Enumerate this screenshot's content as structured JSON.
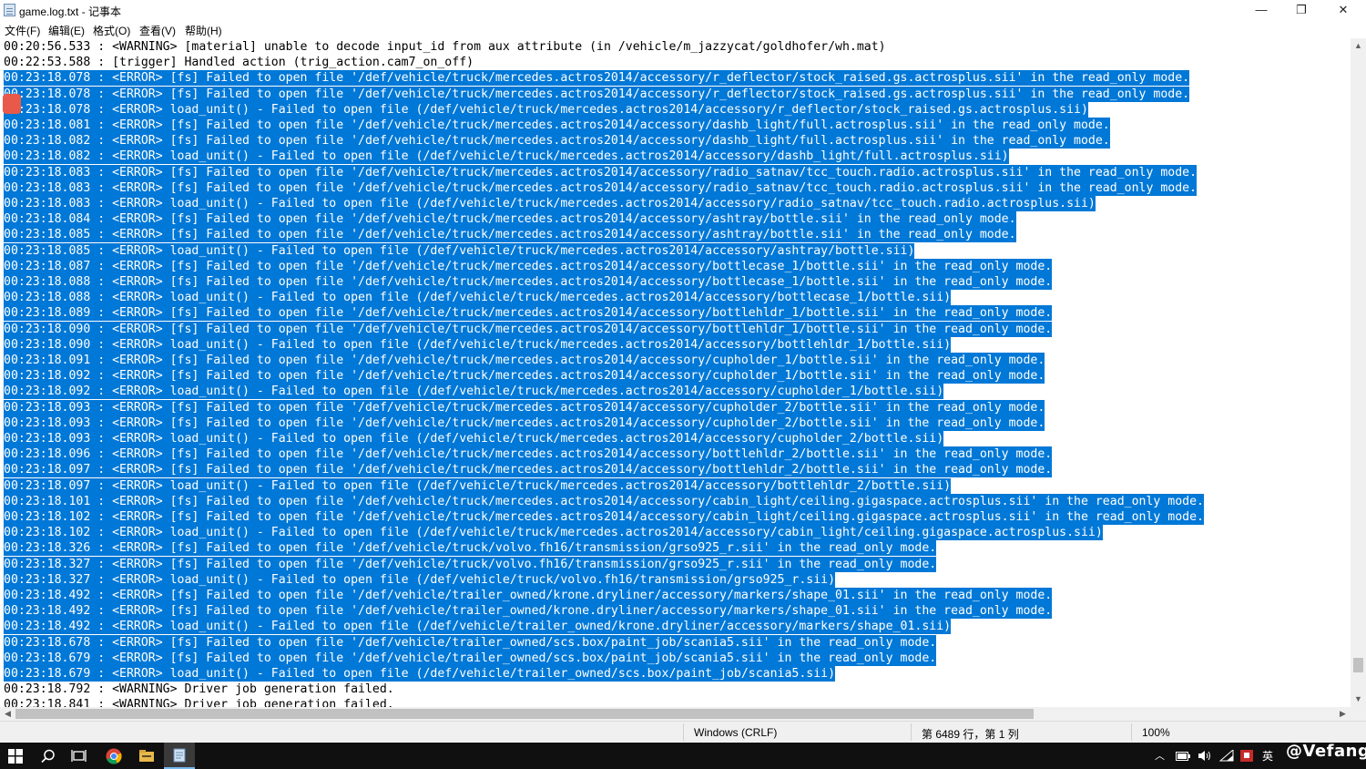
{
  "window": {
    "title": "game.log.txt - 记事本",
    "minimize": "—",
    "maximize": "❐",
    "close": "✕"
  },
  "menu": [
    "文件(F)",
    "编辑(E)",
    "格式(O)",
    "查看(V)",
    "帮助(H)"
  ],
  "editor": {
    "lines": [
      {
        "text": "00:20:56.533 : <WARNING> [material] unable to decode input_id from aux attribute (in /vehicle/m_jazzycat/goldhofer/wh.mat)",
        "selected": false
      },
      {
        "text": "00:22:53.588 : [trigger] Handled action (trig_action.cam7_on_off)",
        "selected": false
      },
      {
        "text": "00:23:18.078 : <ERROR> [fs] Failed to open file '/def/vehicle/truck/mercedes.actros2014/accessory/r_deflector/stock_raised.gs.actrosplus.sii' in the read_only mode.",
        "selected": true
      },
      {
        "text": "00:23:18.078 : <ERROR> [fs] Failed to open file '/def/vehicle/truck/mercedes.actros2014/accessory/r_deflector/stock_raised.gs.actrosplus.sii' in the read_only mode.",
        "selected": true
      },
      {
        "text": "00:23:18.078 : <ERROR> load_unit() - Failed to open file (/def/vehicle/truck/mercedes.actros2014/accessory/r_deflector/stock_raised.gs.actrosplus.sii)",
        "selected": true
      },
      {
        "text": "00:23:18.081 : <ERROR> [fs] Failed to open file '/def/vehicle/truck/mercedes.actros2014/accessory/dashb_light/full.actrosplus.sii' in the read_only mode.",
        "selected": true
      },
      {
        "text": "00:23:18.082 : <ERROR> [fs] Failed to open file '/def/vehicle/truck/mercedes.actros2014/accessory/dashb_light/full.actrosplus.sii' in the read_only mode.",
        "selected": true
      },
      {
        "text": "00:23:18.082 : <ERROR> load_unit() - Failed to open file (/def/vehicle/truck/mercedes.actros2014/accessory/dashb_light/full.actrosplus.sii)",
        "selected": true
      },
      {
        "text": "00:23:18.083 : <ERROR> [fs] Failed to open file '/def/vehicle/truck/mercedes.actros2014/accessory/radio_satnav/tcc_touch.radio.actrosplus.sii' in the read_only mode.",
        "selected": true
      },
      {
        "text": "00:23:18.083 : <ERROR> [fs] Failed to open file '/def/vehicle/truck/mercedes.actros2014/accessory/radio_satnav/tcc_touch.radio.actrosplus.sii' in the read_only mode.",
        "selected": true
      },
      {
        "text": "00:23:18.083 : <ERROR> load_unit() - Failed to open file (/def/vehicle/truck/mercedes.actros2014/accessory/radio_satnav/tcc_touch.radio.actrosplus.sii)",
        "selected": true
      },
      {
        "text": "00:23:18.084 : <ERROR> [fs] Failed to open file '/def/vehicle/truck/mercedes.actros2014/accessory/ashtray/bottle.sii' in the read_only mode.",
        "selected": true
      },
      {
        "text": "00:23:18.085 : <ERROR> [fs] Failed to open file '/def/vehicle/truck/mercedes.actros2014/accessory/ashtray/bottle.sii' in the read_only mode.",
        "selected": true
      },
      {
        "text": "00:23:18.085 : <ERROR> load_unit() - Failed to open file (/def/vehicle/truck/mercedes.actros2014/accessory/ashtray/bottle.sii)",
        "selected": true
      },
      {
        "text": "00:23:18.087 : <ERROR> [fs] Failed to open file '/def/vehicle/truck/mercedes.actros2014/accessory/bottlecase_1/bottle.sii' in the read_only mode.",
        "selected": true
      },
      {
        "text": "00:23:18.088 : <ERROR> [fs] Failed to open file '/def/vehicle/truck/mercedes.actros2014/accessory/bottlecase_1/bottle.sii' in the read_only mode.",
        "selected": true
      },
      {
        "text": "00:23:18.088 : <ERROR> load_unit() - Failed to open file (/def/vehicle/truck/mercedes.actros2014/accessory/bottlecase_1/bottle.sii)",
        "selected": true
      },
      {
        "text": "00:23:18.089 : <ERROR> [fs] Failed to open file '/def/vehicle/truck/mercedes.actros2014/accessory/bottlehldr_1/bottle.sii' in the read_only mode.",
        "selected": true
      },
      {
        "text": "00:23:18.090 : <ERROR> [fs] Failed to open file '/def/vehicle/truck/mercedes.actros2014/accessory/bottlehldr_1/bottle.sii' in the read_only mode.",
        "selected": true
      },
      {
        "text": "00:23:18.090 : <ERROR> load_unit() - Failed to open file (/def/vehicle/truck/mercedes.actros2014/accessory/bottlehldr_1/bottle.sii)",
        "selected": true
      },
      {
        "text": "00:23:18.091 : <ERROR> [fs] Failed to open file '/def/vehicle/truck/mercedes.actros2014/accessory/cupholder_1/bottle.sii' in the read_only mode.",
        "selected": true
      },
      {
        "text": "00:23:18.092 : <ERROR> [fs] Failed to open file '/def/vehicle/truck/mercedes.actros2014/accessory/cupholder_1/bottle.sii' in the read_only mode.",
        "selected": true
      },
      {
        "text": "00:23:18.092 : <ERROR> load_unit() - Failed to open file (/def/vehicle/truck/mercedes.actros2014/accessory/cupholder_1/bottle.sii)",
        "selected": true
      },
      {
        "text": "00:23:18.093 : <ERROR> [fs] Failed to open file '/def/vehicle/truck/mercedes.actros2014/accessory/cupholder_2/bottle.sii' in the read_only mode.",
        "selected": true
      },
      {
        "text": "00:23:18.093 : <ERROR> [fs] Failed to open file '/def/vehicle/truck/mercedes.actros2014/accessory/cupholder_2/bottle.sii' in the read_only mode.",
        "selected": true
      },
      {
        "text": "00:23:18.093 : <ERROR> load_unit() - Failed to open file (/def/vehicle/truck/mercedes.actros2014/accessory/cupholder_2/bottle.sii)",
        "selected": true
      },
      {
        "text": "00:23:18.096 : <ERROR> [fs] Failed to open file '/def/vehicle/truck/mercedes.actros2014/accessory/bottlehldr_2/bottle.sii' in the read_only mode.",
        "selected": true
      },
      {
        "text": "00:23:18.097 : <ERROR> [fs] Failed to open file '/def/vehicle/truck/mercedes.actros2014/accessory/bottlehldr_2/bottle.sii' in the read_only mode.",
        "selected": true
      },
      {
        "text": "00:23:18.097 : <ERROR> load_unit() - Failed to open file (/def/vehicle/truck/mercedes.actros2014/accessory/bottlehldr_2/bottle.sii)",
        "selected": true
      },
      {
        "text": "00:23:18.101 : <ERROR> [fs] Failed to open file '/def/vehicle/truck/mercedes.actros2014/accessory/cabin_light/ceiling.gigaspace.actrosplus.sii' in the read_only mode.",
        "selected": true
      },
      {
        "text": "00:23:18.102 : <ERROR> [fs] Failed to open file '/def/vehicle/truck/mercedes.actros2014/accessory/cabin_light/ceiling.gigaspace.actrosplus.sii' in the read_only mode.",
        "selected": true
      },
      {
        "text": "00:23:18.102 : <ERROR> load_unit() - Failed to open file (/def/vehicle/truck/mercedes.actros2014/accessory/cabin_light/ceiling.gigaspace.actrosplus.sii)",
        "selected": true
      },
      {
        "text": "00:23:18.326 : <ERROR> [fs] Failed to open file '/def/vehicle/truck/volvo.fh16/transmission/grso925_r.sii' in the read_only mode.",
        "selected": true
      },
      {
        "text": "00:23:18.327 : <ERROR> [fs] Failed to open file '/def/vehicle/truck/volvo.fh16/transmission/grso925_r.sii' in the read_only mode.",
        "selected": true
      },
      {
        "text": "00:23:18.327 : <ERROR> load_unit() - Failed to open file (/def/vehicle/truck/volvo.fh16/transmission/grso925_r.sii)",
        "selected": true
      },
      {
        "text": "00:23:18.492 : <ERROR> [fs] Failed to open file '/def/vehicle/trailer_owned/krone.dryliner/accessory/markers/shape_01.sii' in the read_only mode.",
        "selected": true
      },
      {
        "text": "00:23:18.492 : <ERROR> [fs] Failed to open file '/def/vehicle/trailer_owned/krone.dryliner/accessory/markers/shape_01.sii' in the read_only mode.",
        "selected": true
      },
      {
        "text": "00:23:18.492 : <ERROR> load_unit() - Failed to open file (/def/vehicle/trailer_owned/krone.dryliner/accessory/markers/shape_01.sii)",
        "selected": true
      },
      {
        "text": "00:23:18.678 : <ERROR> [fs] Failed to open file '/def/vehicle/trailer_owned/scs.box/paint_job/scania5.sii' in the read_only mode.",
        "selected": true
      },
      {
        "text": "00:23:18.679 : <ERROR> [fs] Failed to open file '/def/vehicle/trailer_owned/scs.box/paint_job/scania5.sii' in the read_only mode.",
        "selected": true
      },
      {
        "text": "00:23:18.679 : <ERROR> load_unit() - Failed to open file (/def/vehicle/trailer_owned/scs.box/paint_job/scania5.sii)",
        "selected": true
      },
      {
        "text": "00:23:18.792 : <WARNING> Driver job generation failed.",
        "selected": false
      },
      {
        "text": "00:23:18.841 : <WARNING> Driver job generation failed.",
        "selected": false
      }
    ]
  },
  "status": {
    "encoding": "Windows (CRLF)",
    "position": "第 6489 行，第 1 列",
    "zoom": "100%"
  },
  "taskbar": {
    "tray_lang": "英",
    "watermark": "@Vefang"
  },
  "colors": {
    "selection": "#0078d7",
    "taskbar": "#101010",
    "statusbar": "#f0f0f0"
  }
}
